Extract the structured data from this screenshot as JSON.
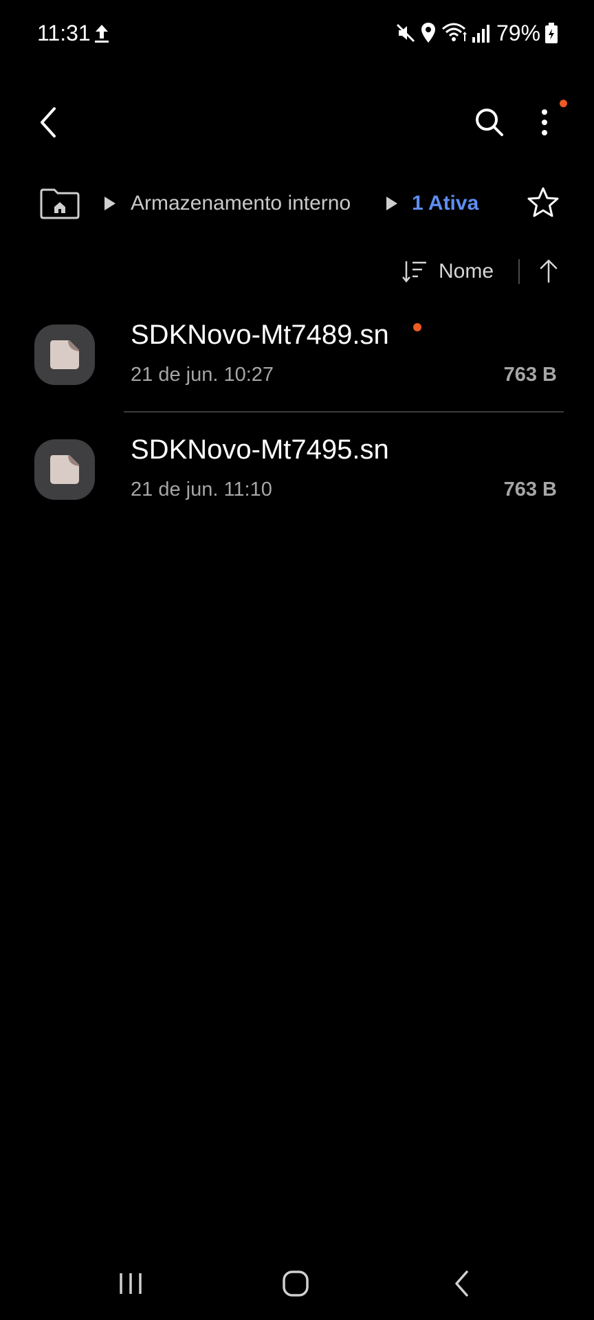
{
  "status_bar": {
    "time": "11:31",
    "battery": "79%",
    "icons": [
      "upload-icon",
      "mute-icon",
      "location-icon",
      "wifi-icon",
      "signal-icon",
      "battery-icon"
    ]
  },
  "toolbar": {
    "back_icon": "back-arrow-icon",
    "search_icon": "search-icon",
    "more_icon": "more-vert-icon",
    "notification_color": "#ee5a24"
  },
  "breadcrumb": {
    "home_icon": "home-folder-icon",
    "items": [
      {
        "label": "Armazenamento interno",
        "active": false
      },
      {
        "label": "1 Ativa",
        "active": true
      }
    ],
    "favorite_icon": "star-icon",
    "active_color": "#5d8ef1"
  },
  "sort": {
    "label": "Nome",
    "sort_icon": "sort-icon",
    "direction_icon": "arrow-up-icon"
  },
  "files": [
    {
      "name": "SDKNovo-Mt7489.sn",
      "date": "21 de jun. 10:27",
      "size": "763 B",
      "new": true
    },
    {
      "name": "SDKNovo-Mt7495.sn",
      "date": "21 de jun. 11:10",
      "size": "763 B",
      "new": false
    }
  ],
  "nav_bar": {
    "recents_icon": "recents-icon",
    "home_icon": "home-icon",
    "back_icon": "back-icon"
  }
}
